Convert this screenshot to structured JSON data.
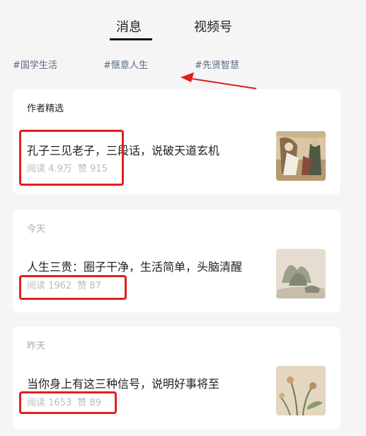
{
  "tabs": [
    {
      "label": "消息"
    },
    {
      "label": "视频号"
    }
  ],
  "hashtags": [
    "#国学生活",
    "#惬意人生",
    "#先贤智慧"
  ],
  "cards": [
    {
      "header": "作者精选",
      "title": "孔子三见老子，三段话，说破天道玄机",
      "reads": "阅读 4.9万",
      "likes": "赞 915"
    },
    {
      "header": "今天",
      "title": "人生三贵：圈子干净，生活简单，头脑清醒",
      "reads": "阅读 1962",
      "likes": "赞 87"
    },
    {
      "header": "昨天",
      "title": "当你身上有这三种信号，说明好事将至",
      "reads": "阅读 1653",
      "likes": "赞 89"
    }
  ],
  "colors": {
    "highlight": "#e02020",
    "tag": "#5a6a85",
    "muted": "#bbbbbb"
  }
}
